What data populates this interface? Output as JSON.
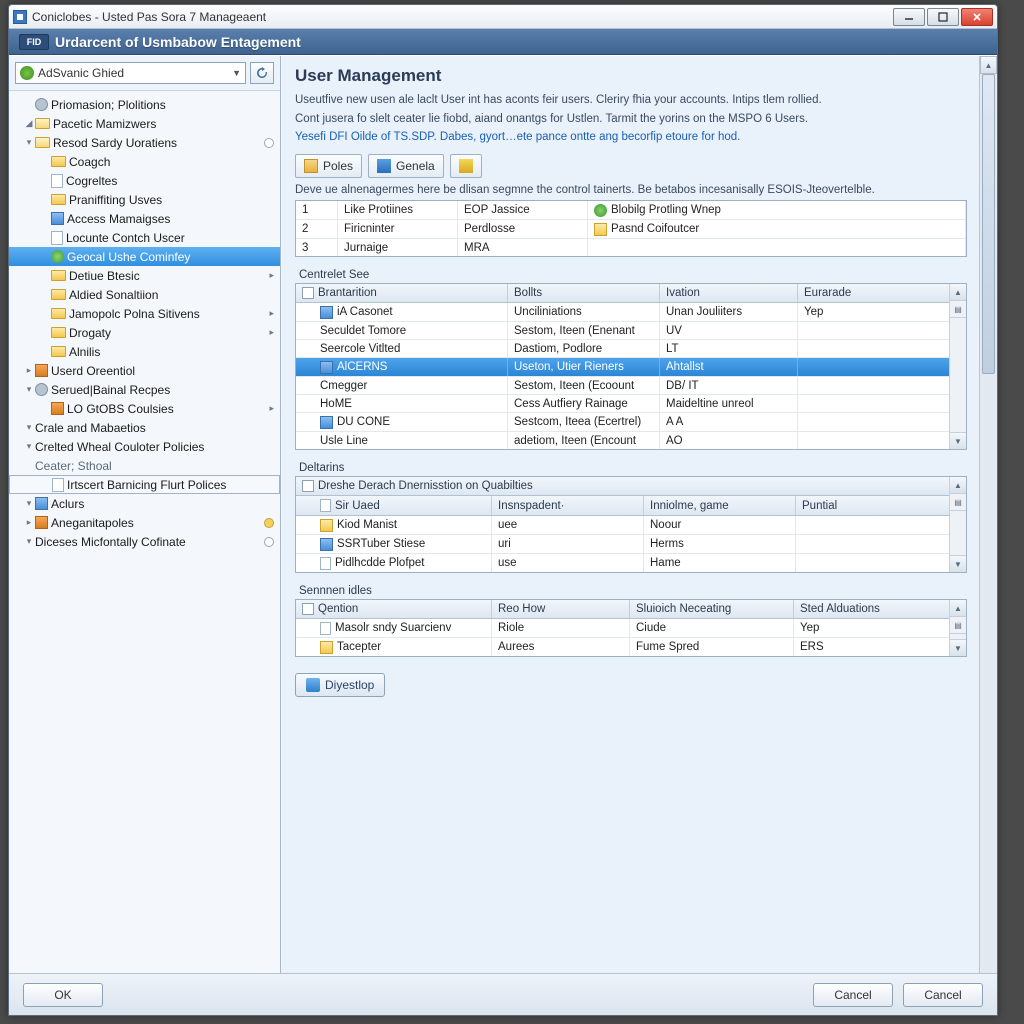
{
  "window": {
    "title": "Coniclobes - Usted Pas Sora 7 Manageaent"
  },
  "banner": {
    "logo": "FID",
    "title": "Urdarcent of Usmbabow Entagement"
  },
  "sidebar": {
    "combo": "AdSvanic Ghied",
    "nodes": [
      {
        "d": 1,
        "tw": "",
        "ic": "gear",
        "label": "Priomasion; Plolitions"
      },
      {
        "d": 1,
        "tw": "◢",
        "ic": "folder-o",
        "label": "Pacetic Mamizwers"
      },
      {
        "d": 1,
        "tw": "▾",
        "ic": "folder-o",
        "label": "Resod Sardy Uoratiens",
        "rdot": true
      },
      {
        "d": 2,
        "tw": "",
        "ic": "folder",
        "label": "Coagch"
      },
      {
        "d": 2,
        "tw": "",
        "ic": "page",
        "label": "Cogreltes"
      },
      {
        "d": 2,
        "tw": "",
        "ic": "folder",
        "label": "Praniffiting Usves"
      },
      {
        "d": 2,
        "tw": "",
        "ic": "blue",
        "label": "Access Mamaigses"
      },
      {
        "d": 2,
        "tw": "",
        "ic": "page",
        "label": "Locunte Contch Uscer"
      },
      {
        "d": 2,
        "tw": "",
        "ic": "green",
        "label": "Geocal Ushe Cominfey",
        "sel": true
      },
      {
        "d": 2,
        "tw": "",
        "ic": "folder",
        "label": "Detiue Btesic",
        "rchev": true
      },
      {
        "d": 2,
        "tw": "",
        "ic": "folder",
        "label": "Aldied Sonaltiion"
      },
      {
        "d": 2,
        "tw": "",
        "ic": "folder",
        "label": "Jamopolc Polna Sitivens",
        "rchev": true
      },
      {
        "d": 2,
        "tw": "",
        "ic": "folder",
        "label": "Drogaty",
        "rchev": true
      },
      {
        "d": 2,
        "tw": "",
        "ic": "folder",
        "label": "Alnilis"
      },
      {
        "d": 1,
        "tw": "▸",
        "ic": "org",
        "label": "Userd Oreentiol"
      },
      {
        "d": 1,
        "tw": "▾",
        "ic": "gear",
        "label": "Serued|Bainal Recpes"
      },
      {
        "d": 2,
        "tw": "",
        "ic": "org",
        "label": "LO GtOBS Coulsies",
        "rchev": true
      },
      {
        "d": 1,
        "tw": "▾",
        "ic": "",
        "label": "Crale and Mabaetios"
      },
      {
        "d": 1,
        "tw": "▾",
        "ic": "",
        "label": "Crelted Wheal Couloter Policies"
      },
      {
        "d": 1,
        "tw": "",
        "ic": "",
        "label": "Ceater; Sthoal",
        "dim": true
      },
      {
        "d": 2,
        "tw": "",
        "ic": "page",
        "label": "Irtscert Barnicing Flurt Polices",
        "box": true
      },
      {
        "d": 1,
        "tw": "▾",
        "ic": "blue",
        "label": "Aclurs"
      },
      {
        "d": 1,
        "tw": "▸",
        "ic": "org",
        "label": "Aneganitapoles",
        "mark": true
      },
      {
        "d": 1,
        "tw": "▾",
        "ic": "",
        "label": "Diceses Micfontally Cofinate",
        "rdot": true
      }
    ]
  },
  "main": {
    "title": "User Management",
    "desc1": "Useutfive new usen ale laclt User int has aconts feir users. Cleriry fhia your accounts. Intips tlem rollied.",
    "desc2": "Cont jusera fo slelt ceater lie fiobd, aiand onantgs for Ustlen. Tarmit the yorins on the MSPO 6 Users.",
    "desc3": "Yesefi DFI Oilde of TS.SDP. Dabes, gyort…ete pance ontte ang becorfip etoure for hod.",
    "toolbar": {
      "b1": "Poles",
      "b2": "Genela",
      "b3": ""
    },
    "hint": "Deve ue alnenagermes here be dlisan segmne the control tainerts. Be betabos incesanisally ESOIS-Jteovertelble.",
    "table1": {
      "headers": [
        "",
        "",
        "",
        ""
      ],
      "rows": [
        [
          "1",
          "Like Protiines",
          "EOP Jassice",
          "Blobilg Protling Wnep",
          "grn"
        ],
        [
          "2",
          "Firicninter",
          "Perdlosse",
          "Pasnd Coifoutcer",
          "fld"
        ],
        [
          "3",
          "Jurnaige",
          "MRA",
          "",
          ""
        ]
      ]
    },
    "sec2_label": "Centrelet See",
    "table2": {
      "headers": [
        "Brantarition",
        "Bollts",
        "Ivation",
        "Eurarade"
      ],
      "rows": [
        {
          "c": [
            "iA Casonet",
            "Unciliniations",
            "Unan Jouliiters",
            "Yep"
          ],
          "ic": "blu"
        },
        {
          "c": [
            "Seculdet Tomore",
            "Sestom, Iteen (Enenant",
            "UV",
            ""
          ],
          "ic": ""
        },
        {
          "c": [
            "Seercole Vitlted",
            "Dastiom, Podlore",
            "LT",
            ""
          ],
          "ic": ""
        },
        {
          "c": [
            "AlCERNS",
            "Useton, Utier Rieners",
            "Ahtallst",
            ""
          ],
          "ic": "blu",
          "sel": true
        },
        {
          "c": [
            "Cmegger",
            "Sestom, Iteen (Ecoount",
            "DB/ IT",
            ""
          ],
          "ic": ""
        },
        {
          "c": [
            "HoME",
            "Cess Autfiery Rainage",
            "Maideltine unreol",
            ""
          ],
          "ic": ""
        },
        {
          "c": [
            "DU CONE",
            "Sestcom, Iteea (Ecertrel)",
            "A A",
            ""
          ],
          "ic": "blu"
        },
        {
          "c": [
            "Usle Line",
            "adetiom, Iteen (Encount",
            "AO",
            ""
          ],
          "ic": ""
        }
      ]
    },
    "sec3_label": "Deltarins",
    "table3header_extra": "Dreshe Derach Dnernisstion on Quabilties",
    "table3": {
      "headers": [
        "Sir Uaed",
        "Insnspadent·",
        "Inniolme, game",
        "Puntial"
      ],
      "rows": [
        {
          "c": [
            "Kiod Manist",
            "uee",
            "Noour",
            ""
          ],
          "ic": "fld"
        },
        {
          "c": [
            "SSRTuber Stiese",
            "uri",
            "Herms",
            ""
          ],
          "ic": "blu"
        },
        {
          "c": [
            "Pidlhcdde Plofpet",
            "use",
            "Hame",
            ""
          ],
          "ic": "pg"
        }
      ]
    },
    "sec4_label": "Sennnen idles",
    "table4": {
      "headers": [
        "Qention",
        "Reo How",
        "Sluioich Neceating",
        "Sted Alduations"
      ],
      "rows": [
        {
          "c": [
            "Masolr sndy Suarcienv",
            "Riole",
            "Ciude",
            "Yep"
          ],
          "ic": "pg"
        },
        {
          "c": [
            "Tacepter",
            "Aurees",
            "Fume Spred",
            "ERS"
          ],
          "ic": "fld"
        }
      ]
    },
    "action": "Diyestlop"
  },
  "footer": {
    "ok": "OK",
    "cancel1": "Cancel",
    "cancel2": "Cancel"
  }
}
